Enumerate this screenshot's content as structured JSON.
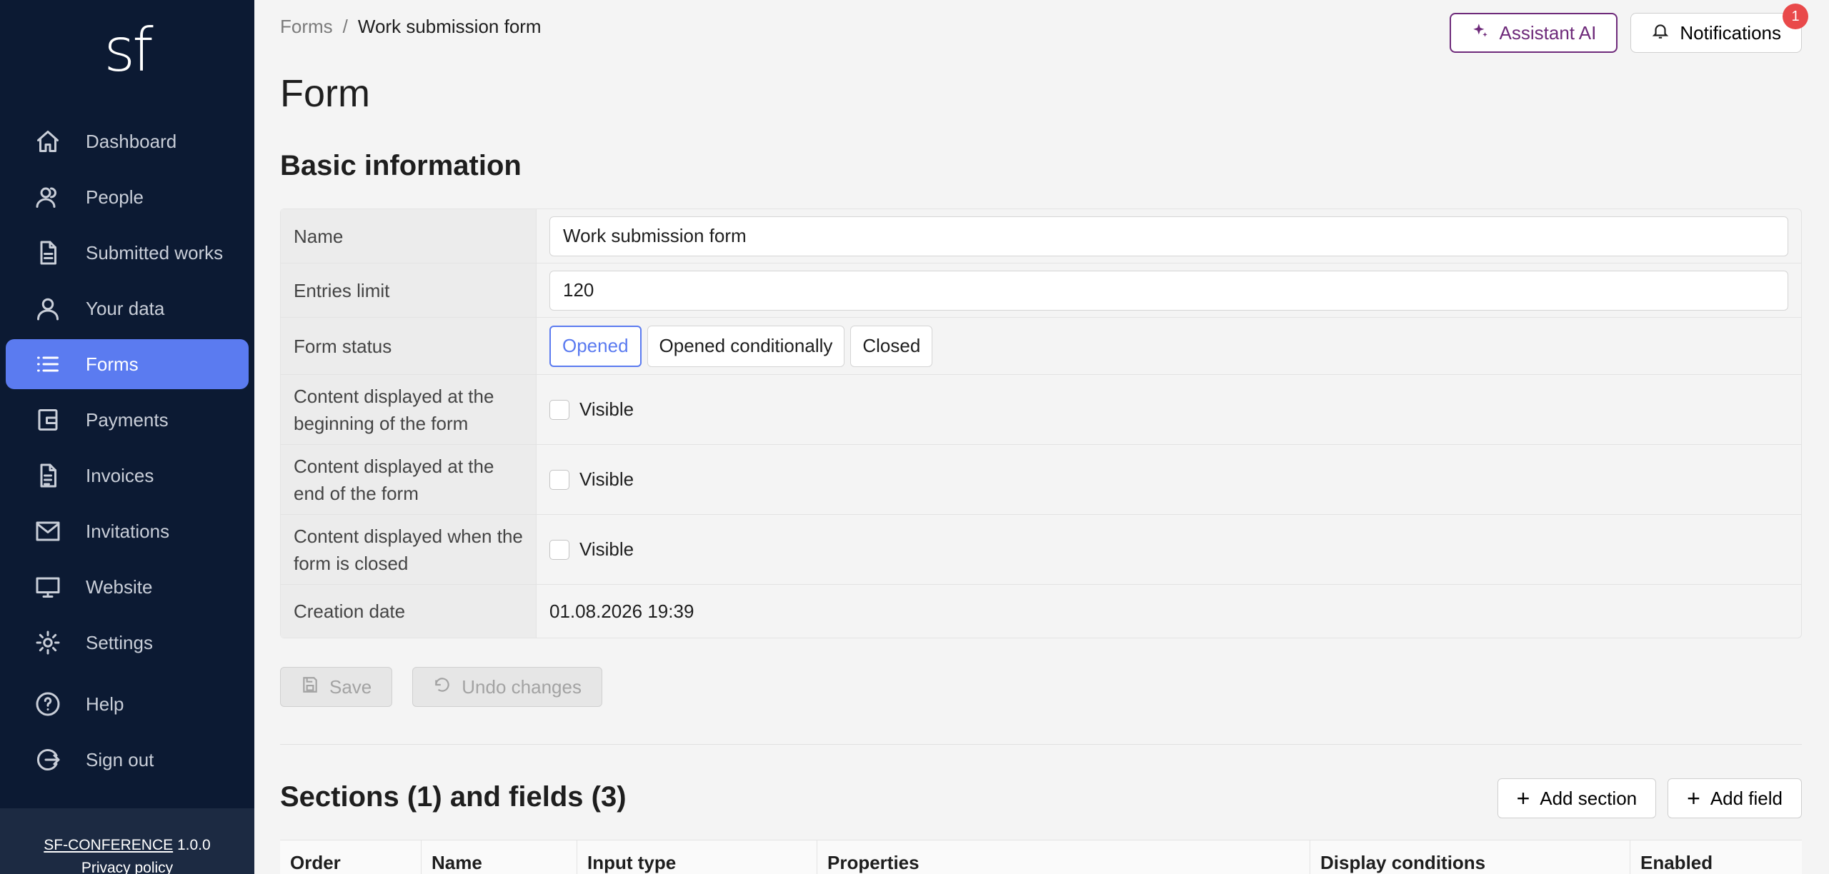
{
  "sidebar": {
    "logo": "sf",
    "items": [
      {
        "label": "Dashboard",
        "icon": "home-icon"
      },
      {
        "label": "People",
        "icon": "people-icon"
      },
      {
        "label": "Submitted works",
        "icon": "document-icon"
      },
      {
        "label": "Your data",
        "icon": "user-icon"
      },
      {
        "label": "Forms",
        "icon": "list-icon",
        "active": true
      },
      {
        "label": "Payments",
        "icon": "wallet-icon"
      },
      {
        "label": "Invoices",
        "icon": "invoice-icon"
      },
      {
        "label": "Invitations",
        "icon": "mail-icon"
      },
      {
        "label": "Website",
        "icon": "monitor-icon"
      },
      {
        "label": "Settings",
        "icon": "gear-icon"
      },
      {
        "label": "Help",
        "icon": "help-icon"
      },
      {
        "label": "Sign out",
        "icon": "sign-out-icon"
      }
    ],
    "footer": {
      "app_name": "SF-CONFERENCE",
      "version": "1.0.0",
      "privacy": "Privacy policy"
    }
  },
  "breadcrumb": {
    "root": "Forms",
    "separator": "/",
    "current": "Work submission form"
  },
  "header": {
    "assistant_label": "Assistant AI",
    "notifications_label": "Notifications",
    "notifications_count": "1"
  },
  "page": {
    "title": "Form",
    "section_title": "Basic information"
  },
  "form": {
    "name_label": "Name",
    "name_value": "Work submission form",
    "limit_label": "Entries limit",
    "limit_value": "120",
    "status_label": "Form status",
    "status_options": [
      "Opened",
      "Opened conditionally",
      "Closed"
    ],
    "status_selected": "Opened",
    "content_begin_label": "Content displayed at the beginning of the form",
    "content_end_label": "Content displayed at the end of the form",
    "content_closed_label": "Content displayed when the form is closed",
    "visible_label": "Visible",
    "creation_label": "Creation date",
    "creation_value": "01.08.2026 19:39"
  },
  "actions": {
    "save": "Save",
    "undo": "Undo changes"
  },
  "sections": {
    "title": "Sections (1) and fields (3)",
    "add_section": "Add section",
    "add_field": "Add field",
    "columns": [
      "Order",
      "Name",
      "Input type",
      "Properties",
      "Display conditions",
      "Enabled"
    ]
  },
  "colors": {
    "accent": "#5b7bf0",
    "sidebar_bg": "#0c1a33",
    "ai_purple": "#6e2a7a",
    "badge_red": "#e9494a"
  }
}
